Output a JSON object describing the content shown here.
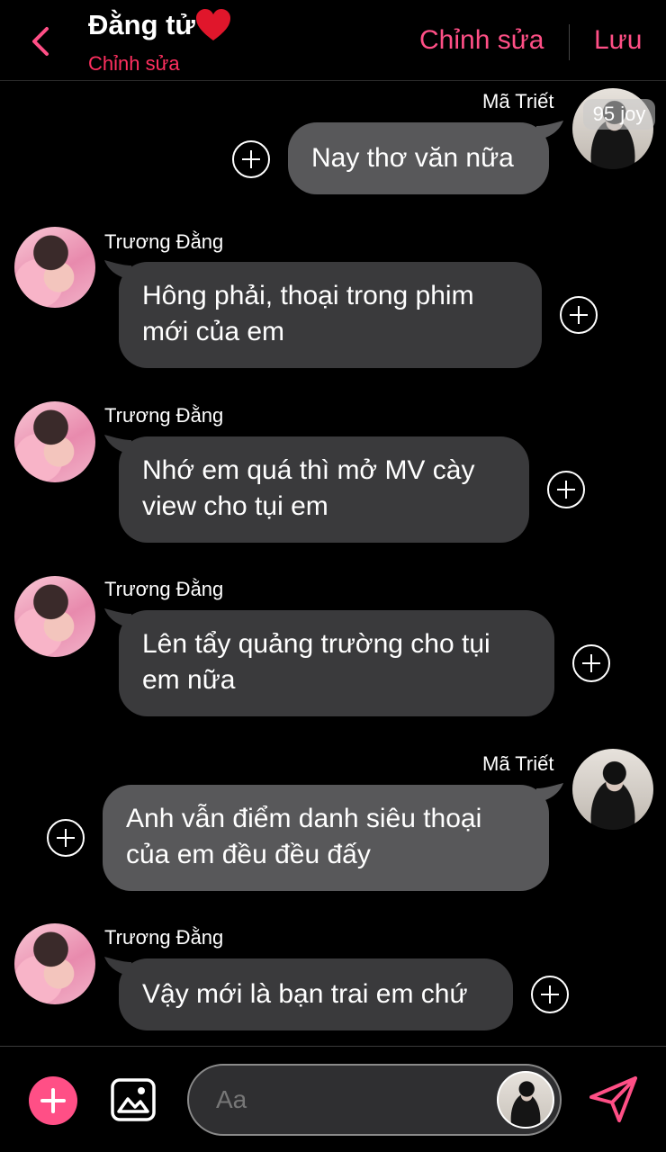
{
  "header": {
    "title": "Đằng tử",
    "subtitle": "Chỉnh sửa",
    "edit_label": "Chỉnh sửa",
    "save_label": "Lưu",
    "accent_color": "#ff4f86"
  },
  "messages": [
    {
      "sender": "Mã Triết",
      "side": "right",
      "text": "Nay thơ văn nữa",
      "avatar_tag": "95 joy"
    },
    {
      "sender": "Trương Đằng",
      "side": "left",
      "text_lines": [
        "Hông phải, thoại trong phim",
        "mới của em"
      ]
    },
    {
      "sender": "Trương Đằng",
      "side": "left",
      "text_lines": [
        "Nhớ em quá thì mở MV cày",
        "view cho tụi em"
      ]
    },
    {
      "sender": "Trương Đằng",
      "side": "left",
      "text_lines": [
        "Lên tẩy quảng trường cho tụi",
        "em nữa"
      ]
    },
    {
      "sender": "Mã Triết",
      "side": "right",
      "text_lines": [
        "Anh vẫn điểm danh siêu thoại",
        "của em đều đều đấy"
      ]
    },
    {
      "sender": "Trương Đằng",
      "side": "left",
      "text": "Vậy mới là bạn trai em chứ"
    }
  ],
  "composer": {
    "placeholder": "Aa"
  },
  "icons": [
    "back-chevron-icon",
    "heart-icon",
    "add-reaction-icon",
    "plus-icon",
    "image-icon",
    "send-icon"
  ]
}
